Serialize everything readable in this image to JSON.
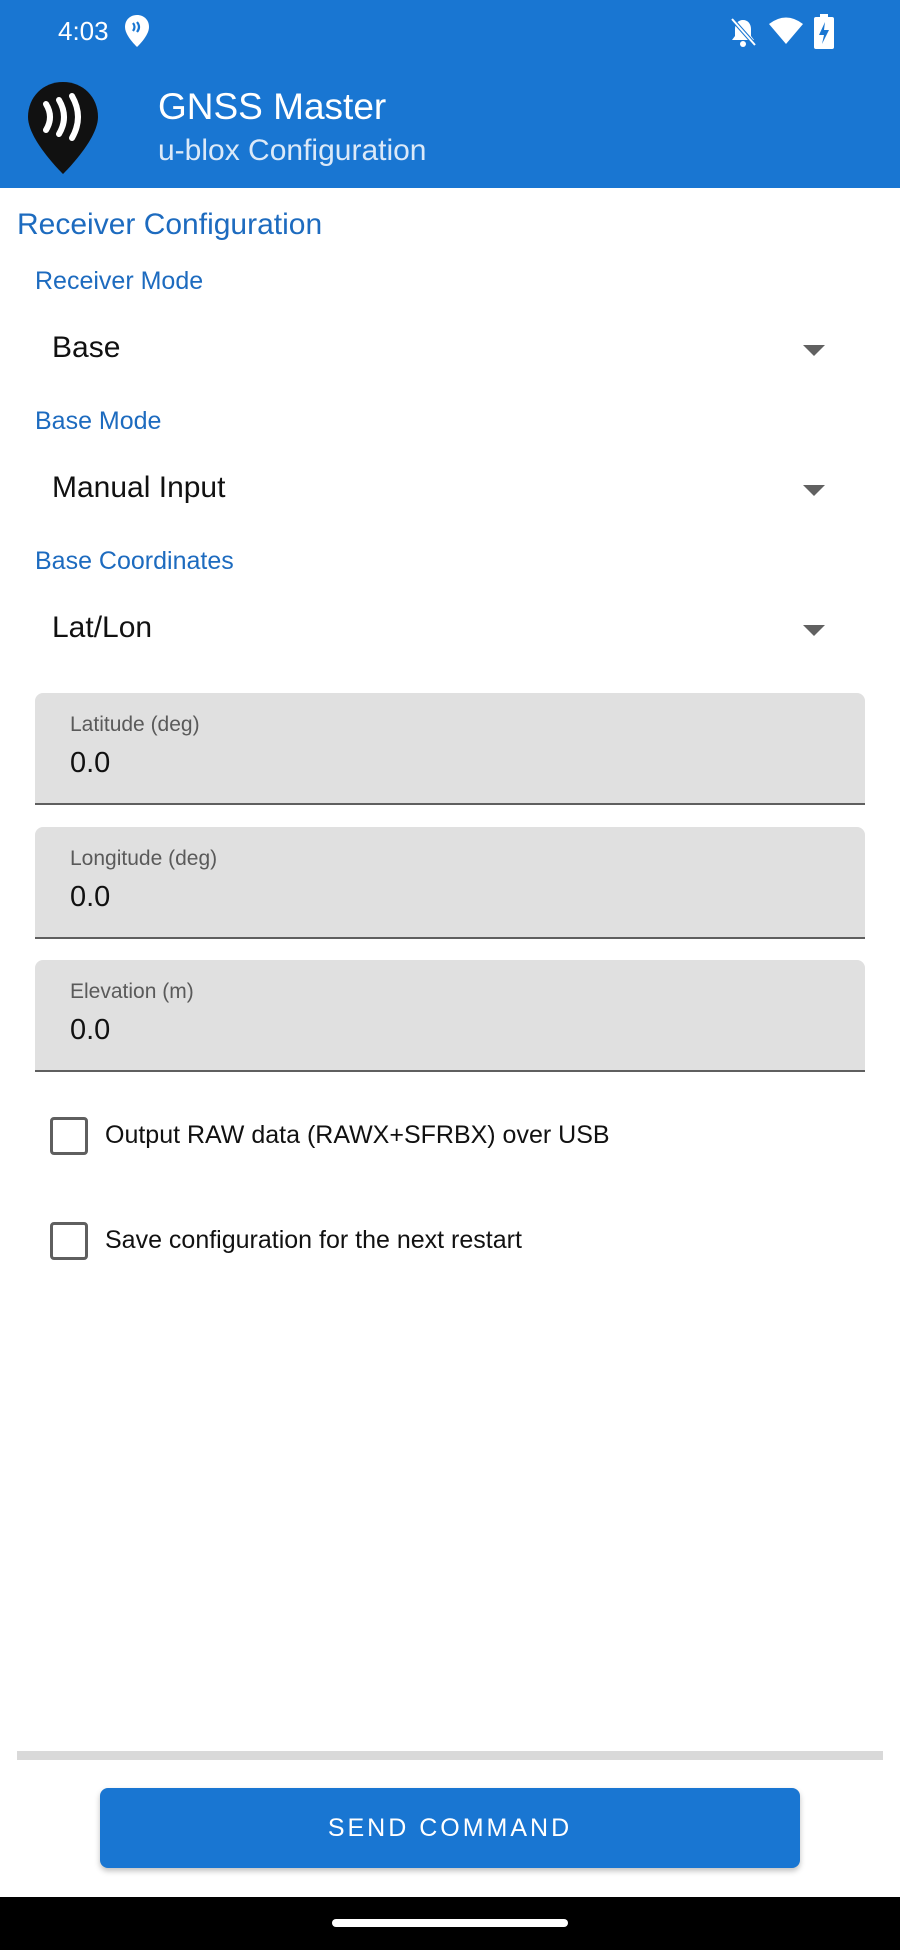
{
  "status_bar": {
    "time": "4:03",
    "icons": [
      "location-pin-icon",
      "notifications-off-icon",
      "wifi-icon",
      "battery-charging-icon"
    ]
  },
  "app_bar": {
    "title": "GNSS Master",
    "subtitle": "u-blox Configuration",
    "logo_icon": "gnss-master-logo-icon"
  },
  "section": {
    "title": "Receiver Configuration"
  },
  "receiver_mode": {
    "label": "Receiver Mode",
    "value": "Base"
  },
  "base_mode": {
    "label": "Base Mode",
    "value": "Manual Input"
  },
  "base_coordinates": {
    "label": "Base Coordinates",
    "value": "Lat/Lon"
  },
  "fields": {
    "latitude": {
      "label": "Latitude (deg)",
      "value": "0.0"
    },
    "longitude": {
      "label": "Longitude (deg)",
      "value": "0.0"
    },
    "elevation": {
      "label": "Elevation (m)",
      "value": "0.0"
    }
  },
  "options": {
    "raw_output": {
      "label": "Output RAW data (RAWX+SFRBX) over USB",
      "checked": false
    },
    "save_config": {
      "label": "Save configuration for the next restart",
      "checked": false
    }
  },
  "actions": {
    "send_label": "SEND COMMAND"
  },
  "colors": {
    "primary": "#1976d2",
    "accent_text": "#1d6bbf",
    "field_background": "#e0e0e0"
  }
}
